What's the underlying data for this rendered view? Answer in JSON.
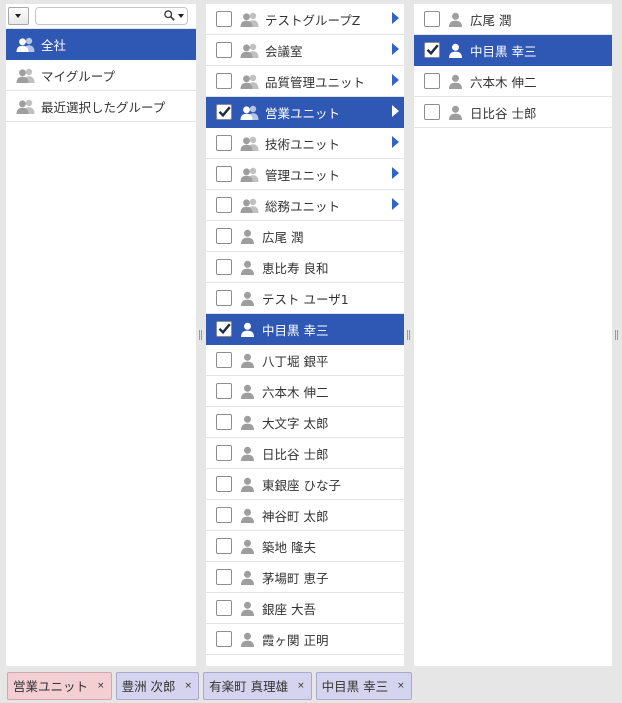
{
  "left_pane": {
    "search": {
      "value": "",
      "placeholder": ""
    },
    "items": [
      {
        "label": "全社",
        "icon": "group-icon",
        "selected": true
      },
      {
        "label": "マイグループ",
        "icon": "group-icon",
        "selected": false
      },
      {
        "label": "最近選択したグループ",
        "icon": "group-icon",
        "selected": false
      }
    ]
  },
  "middle_pane": {
    "groups": [
      {
        "label": "テストグループZ",
        "checked": false,
        "selected": false
      },
      {
        "label": "会議室",
        "checked": false,
        "selected": false
      },
      {
        "label": "品質管理ユニット",
        "checked": false,
        "selected": false
      },
      {
        "label": "営業ユニット",
        "checked": true,
        "selected": true
      },
      {
        "label": "技術ユニット",
        "checked": false,
        "selected": false
      },
      {
        "label": "管理ユニット",
        "checked": false,
        "selected": false
      },
      {
        "label": "総務ユニット",
        "checked": false,
        "selected": false
      }
    ],
    "users": [
      {
        "label": "広尾 潤",
        "checked": false,
        "selected": false
      },
      {
        "label": "恵比寿 良和",
        "checked": false,
        "selected": false
      },
      {
        "label": "テスト ユーザ1",
        "checked": false,
        "selected": false
      },
      {
        "label": "中目黒 幸三",
        "checked": true,
        "selected": true
      },
      {
        "label": "八丁堀 銀平",
        "checked": false,
        "selected": false
      },
      {
        "label": "六本木 伸二",
        "checked": false,
        "selected": false
      },
      {
        "label": "大文字 太郎",
        "checked": false,
        "selected": false
      },
      {
        "label": "日比谷 士郎",
        "checked": false,
        "selected": false
      },
      {
        "label": "東銀座 ひな子",
        "checked": false,
        "selected": false
      },
      {
        "label": "神谷町 太郎",
        "checked": false,
        "selected": false
      },
      {
        "label": "築地 隆夫",
        "checked": false,
        "selected": false
      },
      {
        "label": "茅場町 恵子",
        "checked": false,
        "selected": false
      },
      {
        "label": "銀座 大吾",
        "checked": false,
        "selected": false
      },
      {
        "label": "霞ヶ関 正明",
        "checked": false,
        "selected": false
      }
    ]
  },
  "right_pane": {
    "users": [
      {
        "label": "広尾 潤",
        "checked": false,
        "selected": false
      },
      {
        "label": "中目黒 幸三",
        "checked": true,
        "selected": true
      },
      {
        "label": "六本木 伸二",
        "checked": false,
        "selected": false
      },
      {
        "label": "日比谷 士郎",
        "checked": false,
        "selected": false
      }
    ]
  },
  "selected_tags": [
    {
      "label": "営業ユニット",
      "kind": "group",
      "remove": "×"
    },
    {
      "label": "豊洲 次郎",
      "kind": "user",
      "remove": "×"
    },
    {
      "label": "有楽町 真理雄",
      "kind": "user",
      "remove": "×"
    },
    {
      "label": "中目黒 幸三",
      "kind": "user",
      "remove": "×"
    }
  ],
  "colors": {
    "selected_row": "#2f58b5",
    "arrow": "#3163cc",
    "group_tag": "#f3cfd3",
    "user_tag": "#d4d4ee"
  }
}
